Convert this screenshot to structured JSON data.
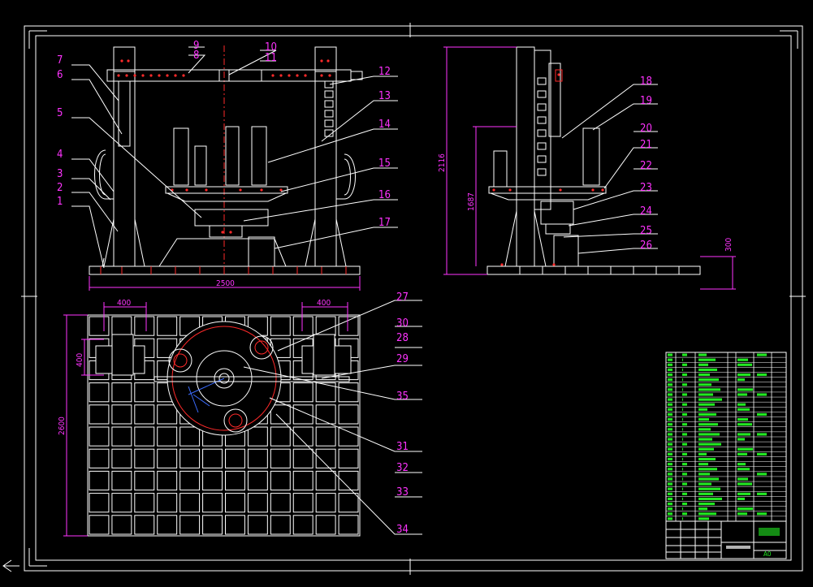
{
  "colors": {
    "background": "#000000",
    "frame": "#ffffff",
    "geometry": "#ffffff",
    "leader": "#ffffff",
    "balloon_text": "#ff33ff",
    "dimension": "#ff33ff",
    "centerline": "#ff2a2a",
    "hidden_detail": "#ff2a2a",
    "accent_blue": "#3b6cff",
    "table_lines": "#ffffff",
    "table_text": "#22e822"
  },
  "front_view": {
    "balloons": [
      "1",
      "2",
      "3",
      "4",
      "5",
      "6",
      "7",
      "8",
      "9",
      "10",
      "11",
      "12",
      "13",
      "14",
      "15",
      "16",
      "17"
    ],
    "width_dimension": "2500"
  },
  "side_view": {
    "balloons": [
      "18",
      "19",
      "20",
      "21",
      "22",
      "23",
      "24",
      "25",
      "26"
    ],
    "height_dimension": "2116",
    "inner_height_dimension": "1687",
    "base_height_dimension": "300"
  },
  "plan_view": {
    "balloons": [
      "27",
      "30",
      "28",
      "29",
      "35",
      "31",
      "32",
      "33",
      "34"
    ],
    "left_offset_dimension": "400",
    "right_offset_dimension": "400",
    "vertical_offset_dimension": "400",
    "height_dimension": "2600"
  },
  "title_block": {
    "scale_code": "A0"
  }
}
